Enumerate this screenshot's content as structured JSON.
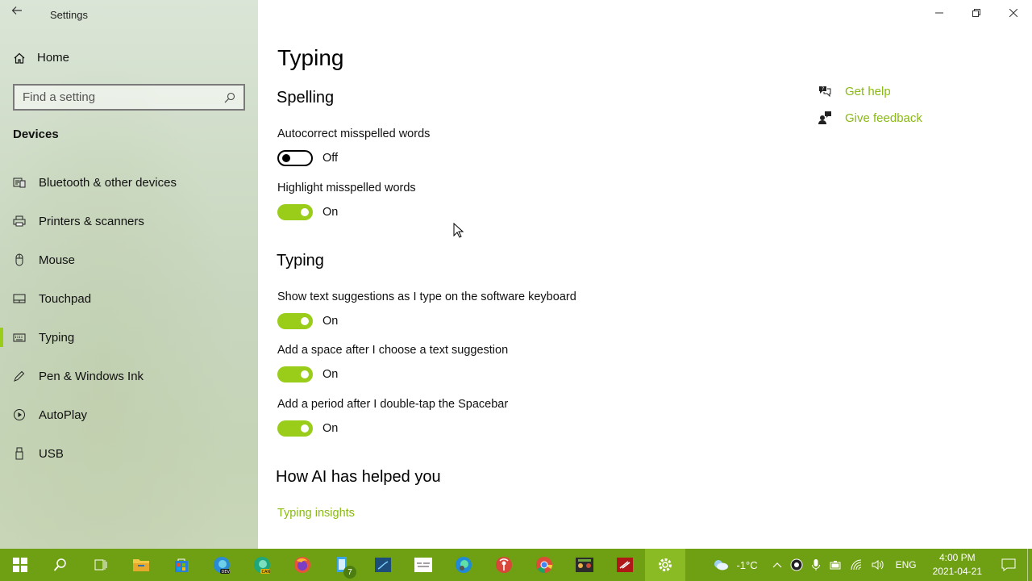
{
  "window": {
    "title": "Settings"
  },
  "sidebar": {
    "home_label": "Home",
    "search_placeholder": "Find a setting",
    "section": "Devices",
    "items": [
      {
        "label": "Bluetooth & other devices",
        "icon": "bluetooth-devices-icon"
      },
      {
        "label": "Printers & scanners",
        "icon": "printer-icon"
      },
      {
        "label": "Mouse",
        "icon": "mouse-icon"
      },
      {
        "label": "Touchpad",
        "icon": "touchpad-icon"
      },
      {
        "label": "Typing",
        "icon": "keyboard-icon",
        "active": true
      },
      {
        "label": "Pen & Windows Ink",
        "icon": "pen-icon"
      },
      {
        "label": "AutoPlay",
        "icon": "autoplay-icon"
      },
      {
        "label": "USB",
        "icon": "usb-icon"
      }
    ]
  },
  "main": {
    "title": "Typing",
    "spelling": {
      "heading": "Spelling",
      "autocorrect": {
        "label": "Autocorrect misspelled words",
        "state": "Off"
      },
      "highlight": {
        "label": "Highlight misspelled words",
        "state": "On"
      }
    },
    "typing": {
      "heading": "Typing",
      "suggestions": {
        "label": "Show text suggestions as I type on the software keyboard",
        "state": "On"
      },
      "space": {
        "label": "Add a space after I choose a text suggestion",
        "state": "On"
      },
      "period": {
        "label": "Add a period after I double-tap the Spacebar",
        "state": "On"
      }
    },
    "ai": {
      "heading": "How AI has helped you",
      "link": "Typing insights"
    },
    "help": {
      "get_help": "Get help",
      "give_feedback": "Give feedback"
    }
  },
  "taskbar": {
    "badge_count": "7",
    "weather": "-1°C",
    "language": "ENG",
    "time": "4:00 PM",
    "date": "2021-04-21"
  },
  "colors": {
    "accent": "#9acd1a",
    "link": "#8aba14",
    "taskbar": "#6f9f13"
  }
}
